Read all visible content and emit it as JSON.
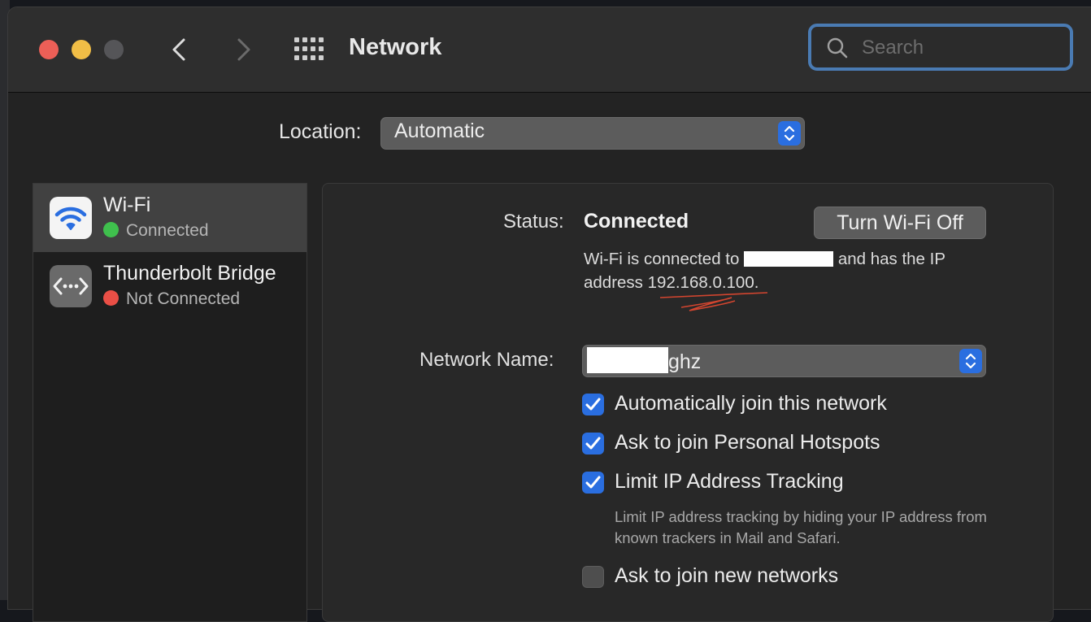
{
  "window": {
    "title": "Network",
    "search": {
      "placeholder": "Search",
      "value": ""
    }
  },
  "location": {
    "label": "Location:",
    "value": "Automatic"
  },
  "services": [
    {
      "name": "Wi-Fi",
      "status": "Connected",
      "status_color": "#3fc04d",
      "icon": "wifi-icon",
      "selected": true
    },
    {
      "name": "Thunderbolt Bridge",
      "status": "Not Connected",
      "status_color": "#ea4f46",
      "icon": "thunderbolt-bridge-icon",
      "selected": false
    }
  ],
  "wifi": {
    "status_label": "Status:",
    "status_value": "Connected",
    "turn_off_label": "Turn Wi-Fi Off",
    "desc_prefix": "Wi-Fi is connected to",
    "desc_middle": "and has the IP address",
    "ip_address": "192.168.0.100",
    "desc_suffix": ".",
    "network_name_label": "Network Name:",
    "network_name_visible_suffix": "ghz",
    "options": [
      {
        "label": "Automatically join this network",
        "checked": true
      },
      {
        "label": "Ask to join Personal Hotspots",
        "checked": true
      },
      {
        "label": "Limit IP Address Tracking",
        "checked": true
      },
      {
        "label": "Ask to join new networks",
        "checked": false
      }
    ],
    "tracking_help": "Limit IP address tracking by hiding your IP address from known trackers in Mail and Safari."
  },
  "colors": {
    "accent": "#2a6ee0",
    "search_focus": "#4a7bb3",
    "connected": "#3fc04d",
    "not_connected": "#ea4f46"
  }
}
